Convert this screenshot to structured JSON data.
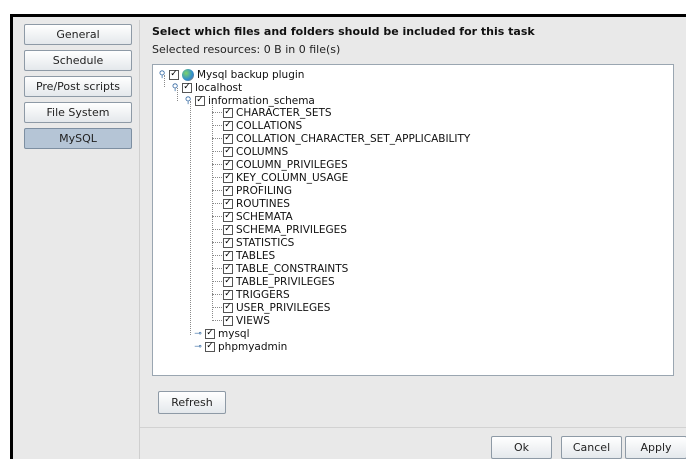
{
  "nav": {
    "items": [
      {
        "label": "General",
        "active": false
      },
      {
        "label": "Schedule",
        "active": false
      },
      {
        "label": "Pre/Post scripts",
        "active": false
      },
      {
        "label": "File System",
        "active": false
      },
      {
        "label": "MySQL",
        "active": true
      }
    ]
  },
  "header": {
    "title": "Select which files and folders should be included for this task",
    "subtitle": "Selected resources: 0 B in 0 file(s)"
  },
  "tree": {
    "root": {
      "label": "Mysql backup plugin",
      "checked": "partial",
      "expanded": true
    },
    "host": {
      "label": "localhost",
      "checked": true,
      "expanded": true
    },
    "schema": {
      "label": "information_schema",
      "checked": true,
      "expanded": true
    },
    "tables": [
      "CHARACTER_SETS",
      "COLLATIONS",
      "COLLATION_CHARACTER_SET_APPLICABILITY",
      "COLUMNS",
      "COLUMN_PRIVILEGES",
      "KEY_COLUMN_USAGE",
      "PROFILING",
      "ROUTINES",
      "SCHEMATA",
      "SCHEMA_PRIVILEGES",
      "STATISTICS",
      "TABLES",
      "TABLE_CONSTRAINTS",
      "TABLE_PRIVILEGES",
      "TRIGGERS",
      "USER_PRIVILEGES",
      "VIEWS"
    ],
    "other_dbs": [
      {
        "label": "mysql",
        "checked": true,
        "expanded": false
      },
      {
        "label": "phpmyadmin",
        "checked": true,
        "expanded": false
      }
    ]
  },
  "buttons": {
    "refresh": "Refresh",
    "ok": "Ok",
    "cancel": "Cancel",
    "apply": "Apply"
  },
  "icons": {
    "expanded": "expanded-toggle-icon",
    "collapsed": "collapsed-toggle-icon",
    "plugin": "plugin-icon",
    "checkbox": "checkbox-icon"
  }
}
